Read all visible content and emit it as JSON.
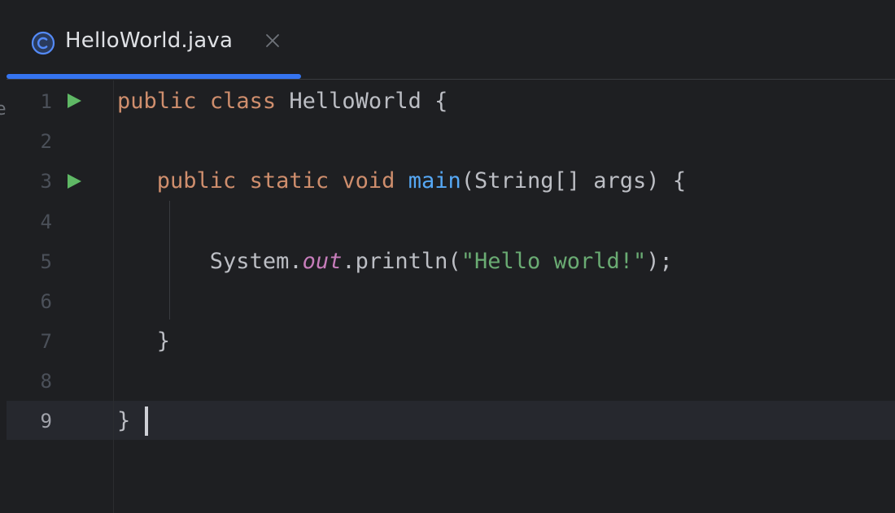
{
  "tab": {
    "filename": "HelloWorld.java",
    "icon": "class-icon",
    "close_icon": "close-icon"
  },
  "sidebar_fragment": "e",
  "gutter": {
    "line_numbers": [
      "1",
      "2",
      "3",
      "4",
      "5",
      "6",
      "7",
      "8",
      "9"
    ],
    "run_markers_on_lines": [
      1,
      3
    ],
    "current_line": 9
  },
  "code": {
    "line1": {
      "kw1": "public",
      "kw2": "class",
      "rest": " HelloWorld {"
    },
    "line3": {
      "indent": "   ",
      "kw1": "public",
      "kw2": "static",
      "kw3": "void",
      "fn": "main",
      "rest": "(String[] args) {"
    },
    "line5": {
      "indent": "       ",
      "pre": "System.",
      "field": "out",
      "mid": ".println(",
      "str": "\"Hello world!\"",
      "post": ");"
    },
    "line7": {
      "indent": "   ",
      "text": "}"
    },
    "line9": {
      "text": "}"
    }
  },
  "colors": {
    "background": "#1e1f22",
    "keyword": "#cf8e6d",
    "function": "#56a8f5",
    "string": "#6aab73",
    "field": "#c77dbb",
    "accent": "#3574f0",
    "run": "#5fb865"
  }
}
